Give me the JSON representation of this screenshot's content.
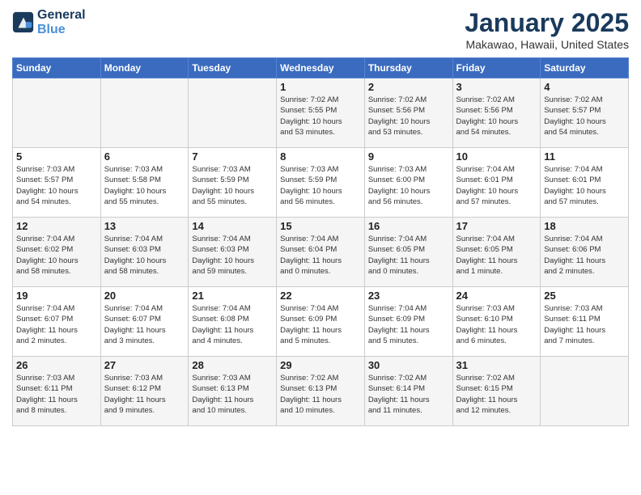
{
  "header": {
    "logo_line1": "General",
    "logo_line2": "Blue",
    "month": "January 2025",
    "location": "Makawao, Hawaii, United States"
  },
  "weekdays": [
    "Sunday",
    "Monday",
    "Tuesday",
    "Wednesday",
    "Thursday",
    "Friday",
    "Saturday"
  ],
  "weeks": [
    [
      {
        "day": "",
        "info": ""
      },
      {
        "day": "",
        "info": ""
      },
      {
        "day": "",
        "info": ""
      },
      {
        "day": "1",
        "info": "Sunrise: 7:02 AM\nSunset: 5:55 PM\nDaylight: 10 hours\nand 53 minutes."
      },
      {
        "day": "2",
        "info": "Sunrise: 7:02 AM\nSunset: 5:56 PM\nDaylight: 10 hours\nand 53 minutes."
      },
      {
        "day": "3",
        "info": "Sunrise: 7:02 AM\nSunset: 5:56 PM\nDaylight: 10 hours\nand 54 minutes."
      },
      {
        "day": "4",
        "info": "Sunrise: 7:02 AM\nSunset: 5:57 PM\nDaylight: 10 hours\nand 54 minutes."
      }
    ],
    [
      {
        "day": "5",
        "info": "Sunrise: 7:03 AM\nSunset: 5:57 PM\nDaylight: 10 hours\nand 54 minutes."
      },
      {
        "day": "6",
        "info": "Sunrise: 7:03 AM\nSunset: 5:58 PM\nDaylight: 10 hours\nand 55 minutes."
      },
      {
        "day": "7",
        "info": "Sunrise: 7:03 AM\nSunset: 5:59 PM\nDaylight: 10 hours\nand 55 minutes."
      },
      {
        "day": "8",
        "info": "Sunrise: 7:03 AM\nSunset: 5:59 PM\nDaylight: 10 hours\nand 56 minutes."
      },
      {
        "day": "9",
        "info": "Sunrise: 7:03 AM\nSunset: 6:00 PM\nDaylight: 10 hours\nand 56 minutes."
      },
      {
        "day": "10",
        "info": "Sunrise: 7:04 AM\nSunset: 6:01 PM\nDaylight: 10 hours\nand 57 minutes."
      },
      {
        "day": "11",
        "info": "Sunrise: 7:04 AM\nSunset: 6:01 PM\nDaylight: 10 hours\nand 57 minutes."
      }
    ],
    [
      {
        "day": "12",
        "info": "Sunrise: 7:04 AM\nSunset: 6:02 PM\nDaylight: 10 hours\nand 58 minutes."
      },
      {
        "day": "13",
        "info": "Sunrise: 7:04 AM\nSunset: 6:03 PM\nDaylight: 10 hours\nand 58 minutes."
      },
      {
        "day": "14",
        "info": "Sunrise: 7:04 AM\nSunset: 6:03 PM\nDaylight: 10 hours\nand 59 minutes."
      },
      {
        "day": "15",
        "info": "Sunrise: 7:04 AM\nSunset: 6:04 PM\nDaylight: 11 hours\nand 0 minutes."
      },
      {
        "day": "16",
        "info": "Sunrise: 7:04 AM\nSunset: 6:05 PM\nDaylight: 11 hours\nand 0 minutes."
      },
      {
        "day": "17",
        "info": "Sunrise: 7:04 AM\nSunset: 6:05 PM\nDaylight: 11 hours\nand 1 minute."
      },
      {
        "day": "18",
        "info": "Sunrise: 7:04 AM\nSunset: 6:06 PM\nDaylight: 11 hours\nand 2 minutes."
      }
    ],
    [
      {
        "day": "19",
        "info": "Sunrise: 7:04 AM\nSunset: 6:07 PM\nDaylight: 11 hours\nand 2 minutes."
      },
      {
        "day": "20",
        "info": "Sunrise: 7:04 AM\nSunset: 6:07 PM\nDaylight: 11 hours\nand 3 minutes."
      },
      {
        "day": "21",
        "info": "Sunrise: 7:04 AM\nSunset: 6:08 PM\nDaylight: 11 hours\nand 4 minutes."
      },
      {
        "day": "22",
        "info": "Sunrise: 7:04 AM\nSunset: 6:09 PM\nDaylight: 11 hours\nand 5 minutes."
      },
      {
        "day": "23",
        "info": "Sunrise: 7:04 AM\nSunset: 6:09 PM\nDaylight: 11 hours\nand 5 minutes."
      },
      {
        "day": "24",
        "info": "Sunrise: 7:03 AM\nSunset: 6:10 PM\nDaylight: 11 hours\nand 6 minutes."
      },
      {
        "day": "25",
        "info": "Sunrise: 7:03 AM\nSunset: 6:11 PM\nDaylight: 11 hours\nand 7 minutes."
      }
    ],
    [
      {
        "day": "26",
        "info": "Sunrise: 7:03 AM\nSunset: 6:11 PM\nDaylight: 11 hours\nand 8 minutes."
      },
      {
        "day": "27",
        "info": "Sunrise: 7:03 AM\nSunset: 6:12 PM\nDaylight: 11 hours\nand 9 minutes."
      },
      {
        "day": "28",
        "info": "Sunrise: 7:03 AM\nSunset: 6:13 PM\nDaylight: 11 hours\nand 10 minutes."
      },
      {
        "day": "29",
        "info": "Sunrise: 7:02 AM\nSunset: 6:13 PM\nDaylight: 11 hours\nand 10 minutes."
      },
      {
        "day": "30",
        "info": "Sunrise: 7:02 AM\nSunset: 6:14 PM\nDaylight: 11 hours\nand 11 minutes."
      },
      {
        "day": "31",
        "info": "Sunrise: 7:02 AM\nSunset: 6:15 PM\nDaylight: 11 hours\nand 12 minutes."
      },
      {
        "day": "",
        "info": ""
      }
    ]
  ]
}
